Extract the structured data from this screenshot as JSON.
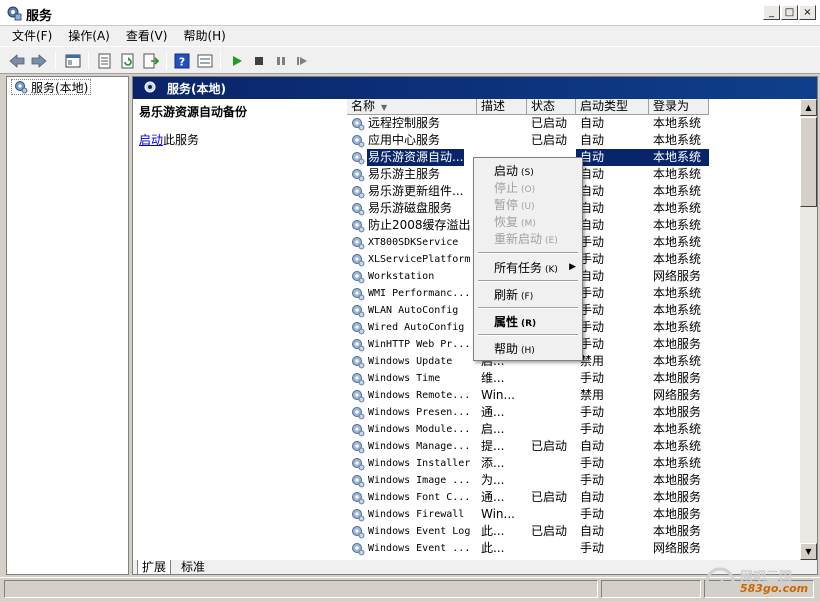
{
  "window": {
    "title": "服务"
  },
  "menu": [
    "文件(F)",
    "操作(A)",
    "查看(V)",
    "帮助(H)"
  ],
  "tree": {
    "item": "服务(本地)"
  },
  "pane": {
    "header": "服务(本地)"
  },
  "detail": {
    "title": "易乐游资源自动备份",
    "link_text": "启动",
    "link_suffix": "此服务"
  },
  "columns": [
    "名称",
    "描述",
    "状态",
    "启动类型",
    "登录为"
  ],
  "rows": [
    {
      "name": "远程控制服务",
      "desc": "",
      "status": "已启动",
      "start": "自动",
      "login": "本地系统"
    },
    {
      "name": "应用中心服务",
      "desc": "",
      "status": "已启动",
      "start": "自动",
      "login": "本地系统"
    },
    {
      "name": "易乐游资源自动...",
      "desc": "",
      "status": "",
      "start": "自动",
      "login": "本地系统"
    },
    {
      "name": "易乐游主服务",
      "desc": "",
      "status": "",
      "start": "自动",
      "login": "本地系统"
    },
    {
      "name": "易乐游更新组件...",
      "desc": "",
      "status": "",
      "start": "自动",
      "login": "本地系统"
    },
    {
      "name": "易乐游磁盘服务",
      "desc": "",
      "status": "",
      "start": "自动",
      "login": "本地系统"
    },
    {
      "name": "防止2008缓存溢出",
      "desc": "",
      "status": "",
      "start": "自动",
      "login": "本地系统"
    },
    {
      "name": "XT800SDKService",
      "desc": "",
      "status": "",
      "start": "手动",
      "login": "本地系统"
    },
    {
      "name": "XLServicePlatform",
      "desc": "",
      "status": "",
      "start": "手动",
      "login": "本地系统"
    },
    {
      "name": "Workstation",
      "desc": "",
      "status": "",
      "start": "自动",
      "login": "网络服务"
    },
    {
      "name": "WMI Performanc...",
      "desc": "",
      "status": "",
      "start": "手动",
      "login": "本地系统"
    },
    {
      "name": "WLAN AutoConfig",
      "desc": "",
      "status": "",
      "start": "手动",
      "login": "本地系统"
    },
    {
      "name": "Wired AutoConfig",
      "desc": "",
      "status": "",
      "start": "手动",
      "login": "本地系统"
    },
    {
      "name": "WinHTTP Web Pr...",
      "desc": "",
      "status": "",
      "start": "手动",
      "login": "本地服务"
    },
    {
      "name": "Windows Update",
      "desc": "启...",
      "status": "",
      "start": "禁用",
      "login": "本地系统"
    },
    {
      "name": "Windows Time",
      "desc": "维...",
      "status": "",
      "start": "手动",
      "login": "本地服务"
    },
    {
      "name": "Windows Remote...",
      "desc": "Win...",
      "status": "",
      "start": "禁用",
      "login": "网络服务"
    },
    {
      "name": "Windows Presen...",
      "desc": "通...",
      "status": "",
      "start": "手动",
      "login": "本地服务"
    },
    {
      "name": "Windows Module...",
      "desc": "启...",
      "status": "",
      "start": "手动",
      "login": "本地系统"
    },
    {
      "name": "Windows Manage...",
      "desc": "提...",
      "status": "已启动",
      "start": "自动",
      "login": "本地系统"
    },
    {
      "name": "Windows Installer",
      "desc": "添...",
      "status": "",
      "start": "手动",
      "login": "本地系统"
    },
    {
      "name": "Windows Image ...",
      "desc": "为...",
      "status": "",
      "start": "手动",
      "login": "本地服务"
    },
    {
      "name": "Windows Font C...",
      "desc": "通...",
      "status": "已启动",
      "start": "自动",
      "login": "本地服务"
    },
    {
      "name": "Windows Firewall",
      "desc": "Win...",
      "status": "",
      "start": "手动",
      "login": "本地服务"
    },
    {
      "name": "Windows Event Log",
      "desc": "此...",
      "status": "已启动",
      "start": "自动",
      "login": "本地服务"
    },
    {
      "name": "Windows Event ...",
      "desc": "此...",
      "status": "",
      "start": "手动",
      "login": "网络服务"
    }
  ],
  "context_menu": {
    "start": {
      "label": "启动",
      "key": "(S)"
    },
    "stop": {
      "label": "停止",
      "key": "(O)"
    },
    "pause": {
      "label": "暂停",
      "key": "(U)"
    },
    "resume": {
      "label": "恢复",
      "key": "(M)"
    },
    "restart": {
      "label": "重新启动",
      "key": "(E)"
    },
    "all_tasks": {
      "label": "所有任务",
      "key": "(K)"
    },
    "refresh": {
      "label": "刷新",
      "key": "(F)"
    },
    "properties": {
      "label": "属性",
      "key": "(R)"
    },
    "help": {
      "label": "帮助",
      "key": "(H)"
    }
  },
  "tabs": [
    "扩展",
    "标准"
  ],
  "watermark": {
    "line1": "网吧三国",
    "line2": "583go.com"
  }
}
